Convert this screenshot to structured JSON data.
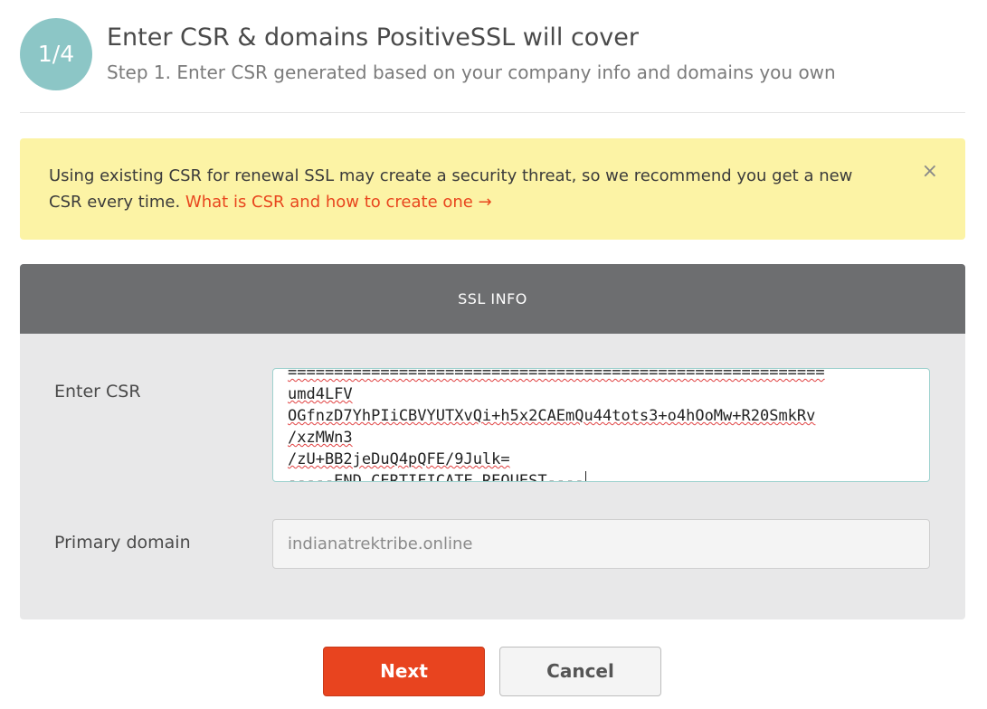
{
  "step": {
    "badge": "1/4",
    "title": "Enter CSR & domains PositiveSSL will cover",
    "subtitle": "Step 1. Enter CSR generated based on your company info and domains you own"
  },
  "alert": {
    "text": "Using existing CSR for renewal SSL may create a security threat, so we recommend you get a new CSR every time.",
    "link": "What is CSR and how to create one →",
    "close_icon": "×"
  },
  "ssl_info": {
    "heading": "SSL INFO",
    "csr_label": "Enter CSR",
    "csr_lines": [
      "umd4LFV",
      "OGfnzD7YhPIiCBVYUTXvQi+h5x2CAEmQu44tots3+o4hOoMw+R20SmkRv",
      "/xzMWn3",
      "/zU+BB2jeDuQ4pQFE/9Julk=",
      "-----END CERTIFICATE REQUEST----"
    ],
    "domain_label": "Primary domain",
    "domain_placeholder": "indianatrektribe.online"
  },
  "buttons": {
    "next": "Next",
    "cancel": "Cancel"
  },
  "colors": {
    "accent": "#e8441f",
    "badge": "#8cc6c6",
    "alert_bg": "#fcf3a5",
    "card_header": "#6d6e70",
    "card_bg": "#e8e8e9",
    "focus_border": "#9fd2cf"
  }
}
